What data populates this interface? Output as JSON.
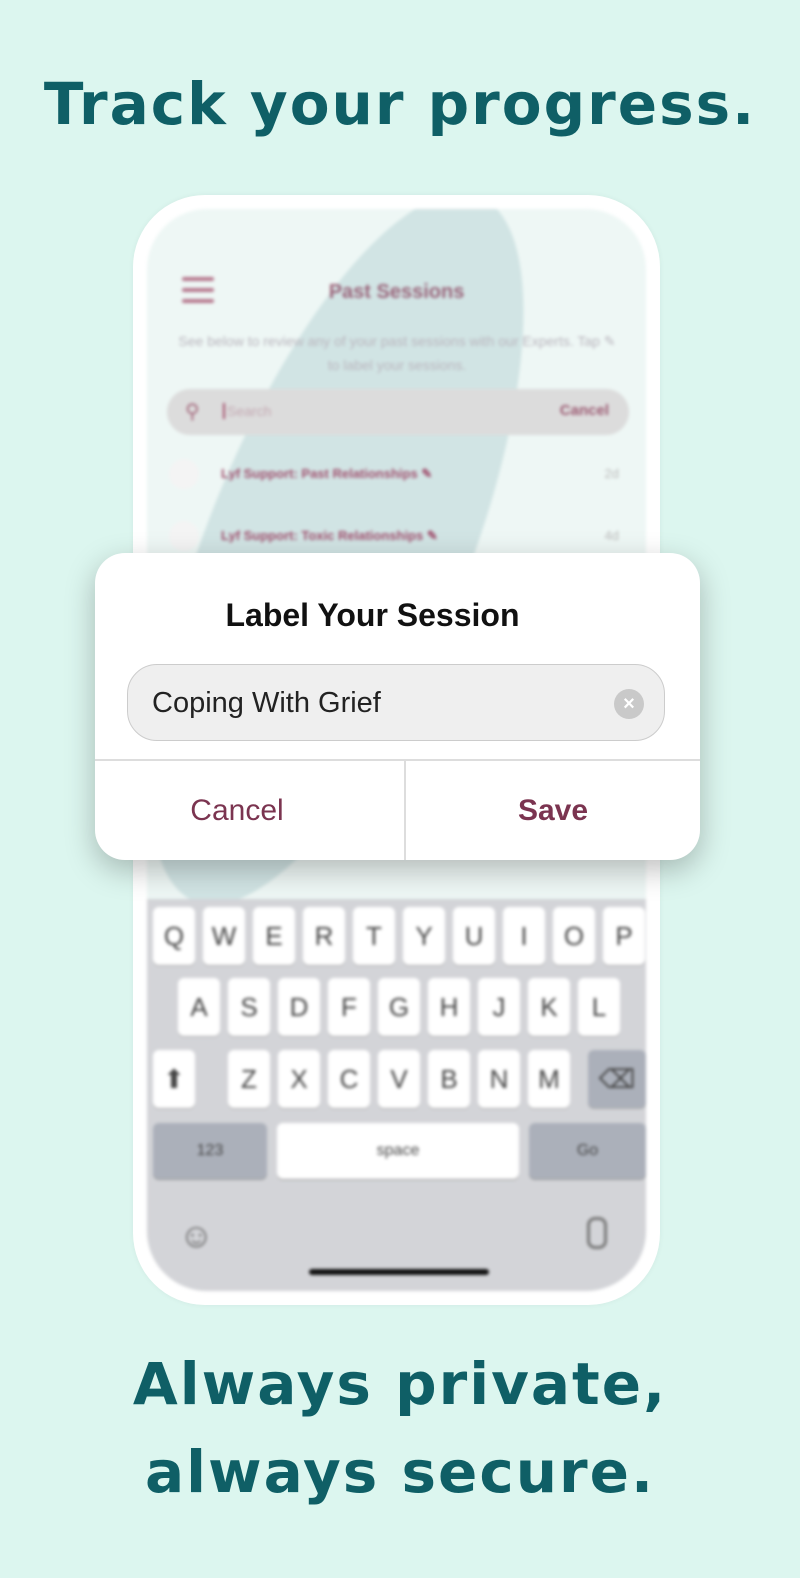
{
  "headline_top": "Track your progress.",
  "headline_bottom_1": "Always private,",
  "headline_bottom_2": "always secure.",
  "colors": {
    "headline": "#0f5f66",
    "accent": "#7b3450",
    "background": "#dcf6ef"
  },
  "background_screen": {
    "title": "Past Sessions",
    "description": "See below to review any of your past sessions with our Experts. Tap ✎ to label your sessions.",
    "search_placeholder": "Search",
    "search_cancel": "Cancel",
    "sessions": [
      {
        "label": "Lyf Support: Past Relationships ✎",
        "time": "2d"
      },
      {
        "label": "Lyf Support: Toxic Relationships ✎",
        "time": "4d"
      }
    ]
  },
  "keyboard": {
    "row1": [
      "Q",
      "W",
      "E",
      "R",
      "T",
      "Y",
      "U",
      "I",
      "O",
      "P"
    ],
    "row2": [
      "A",
      "S",
      "D",
      "F",
      "G",
      "H",
      "J",
      "K",
      "L"
    ],
    "row3": [
      "Z",
      "X",
      "C",
      "V",
      "B",
      "N",
      "M"
    ],
    "shift": "⬆",
    "backspace": "⌫",
    "numbers": "123",
    "space": "space",
    "go": "Go"
  },
  "dialog": {
    "title": "Label Your Session",
    "input_value": "Coping With Grief",
    "cancel": "Cancel",
    "save": "Save"
  }
}
